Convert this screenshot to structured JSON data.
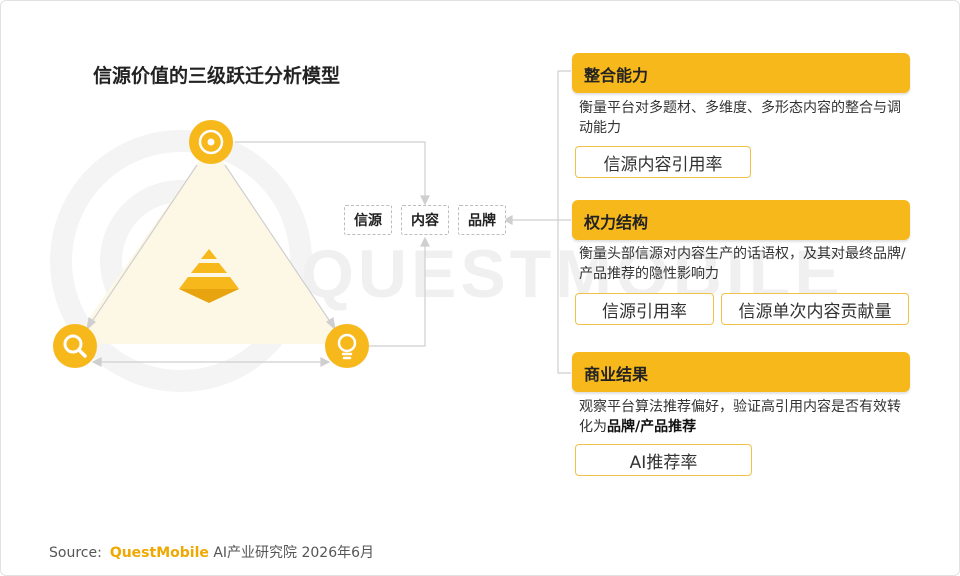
{
  "title": "信源价值的三级跃迁分析模型",
  "watermark_text": "QUESTMOBILE",
  "tags": [
    "信源",
    "内容",
    "品牌"
  ],
  "icons": {
    "top": "target-icon",
    "left": "search-icon",
    "right": "lightbulb-icon",
    "center": "pyramid-icon"
  },
  "categories": [
    {
      "title": "整合能力",
      "desc": "衡量平台对多题材、多维度、多形态内容的整合与调动能力",
      "metrics": [
        "信源内容引用率"
      ]
    },
    {
      "title": "权力结构",
      "desc": "衡量头部信源对内容生产的话语权，及其对最终品牌/产品推荐的隐性影响力",
      "metrics": [
        "信源引用率",
        "信源单次内容贡献量"
      ]
    },
    {
      "title": "商业结果",
      "desc_pre": "观察平台算法推荐偏好，验证高引用内容是否有效转化为",
      "desc_bold": "品牌/产品推荐",
      "metrics": [
        "AI推荐率"
      ]
    }
  ],
  "source": {
    "label": "Source:",
    "brand": "QuestMobile",
    "rest": "AI产业研究院 2026年6月"
  },
  "colors": {
    "accent": "#f6b81b",
    "metric_border": "#f0c24a",
    "line": "#cfcfcf"
  }
}
